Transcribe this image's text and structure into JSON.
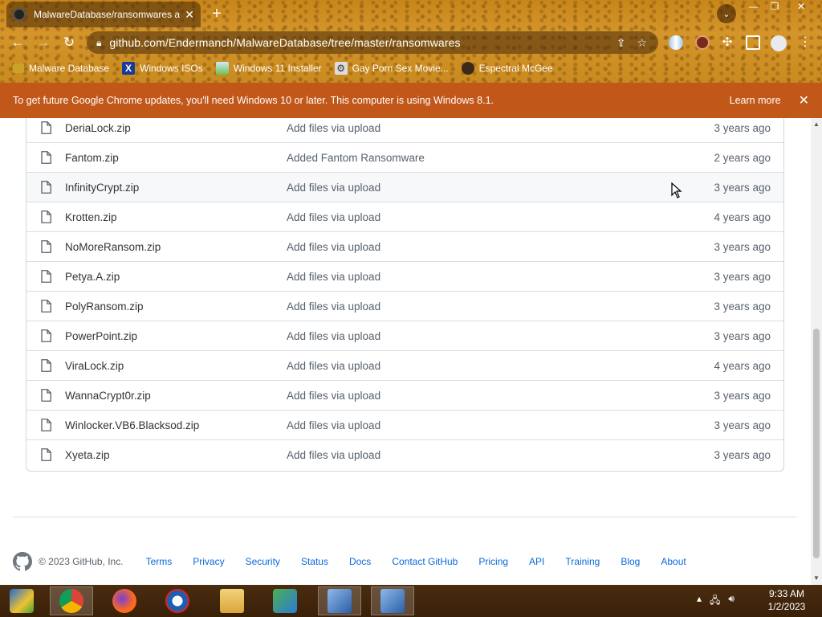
{
  "browser": {
    "tab_title": "MalwareDatabase/ransomwares a",
    "new_tab_symbol": "+",
    "url": "github.com/Endermanch/MalwareDatabase/tree/master/ransomwares",
    "bookmarks": [
      {
        "label": "Malware Database",
        "icon": "folder-icon"
      },
      {
        "label": "Windows ISOs",
        "icon": "x-logo-icon"
      },
      {
        "label": "Windows 11 Installer",
        "icon": "image-icon"
      },
      {
        "label": "Gay Porn Sex Movie...",
        "icon": "site-icon"
      },
      {
        "label": "Espectral McGee",
        "icon": "avatar-icon"
      }
    ],
    "infobar": {
      "message": "To get future Google Chrome updates, you'll need Windows 10 or later. This computer is using Windows 8.1.",
      "learn_more": "Learn more"
    }
  },
  "files": [
    {
      "name": "DeriaLock.zip",
      "commit": "Add files via upload",
      "age": "3 years ago"
    },
    {
      "name": "Fantom.zip",
      "commit": "Added Fantom Ransomware",
      "age": "2 years ago"
    },
    {
      "name": "InfinityCrypt.zip",
      "commit": "Add files via upload",
      "age": "3 years ago"
    },
    {
      "name": "Krotten.zip",
      "commit": "Add files via upload",
      "age": "4 years ago"
    },
    {
      "name": "NoMoreRansom.zip",
      "commit": "Add files via upload",
      "age": "3 years ago"
    },
    {
      "name": "Petya.A.zip",
      "commit": "Add files via upload",
      "age": "3 years ago"
    },
    {
      "name": "PolyRansom.zip",
      "commit": "Add files via upload",
      "age": "3 years ago"
    },
    {
      "name": "PowerPoint.zip",
      "commit": "Add files via upload",
      "age": "3 years ago"
    },
    {
      "name": "ViraLock.zip",
      "commit": "Add files via upload",
      "age": "4 years ago"
    },
    {
      "name": "WannaCrypt0r.zip",
      "commit": "Add files via upload",
      "age": "3 years ago"
    },
    {
      "name": "Winlocker.VB6.Blacksod.zip",
      "commit": "Add files via upload",
      "age": "3 years ago"
    },
    {
      "name": "Xyeta.zip",
      "commit": "Add files via upload",
      "age": "3 years ago"
    }
  ],
  "footer": {
    "copyright": "© 2023 GitHub, Inc.",
    "links": [
      "Terms",
      "Privacy",
      "Security",
      "Status",
      "Docs",
      "Contact GitHub",
      "Pricing",
      "API",
      "Training",
      "Blog",
      "About"
    ]
  },
  "taskbar": {
    "apps": [
      "start-icon",
      "chrome-icon",
      "firefox-icon",
      "obama-icon",
      "file-explorer-icon",
      "network-people-icon",
      "remote-desktop-icon",
      "remote-desktop-icon"
    ],
    "time": "9:33 AM",
    "date": "1/2/2023"
  }
}
